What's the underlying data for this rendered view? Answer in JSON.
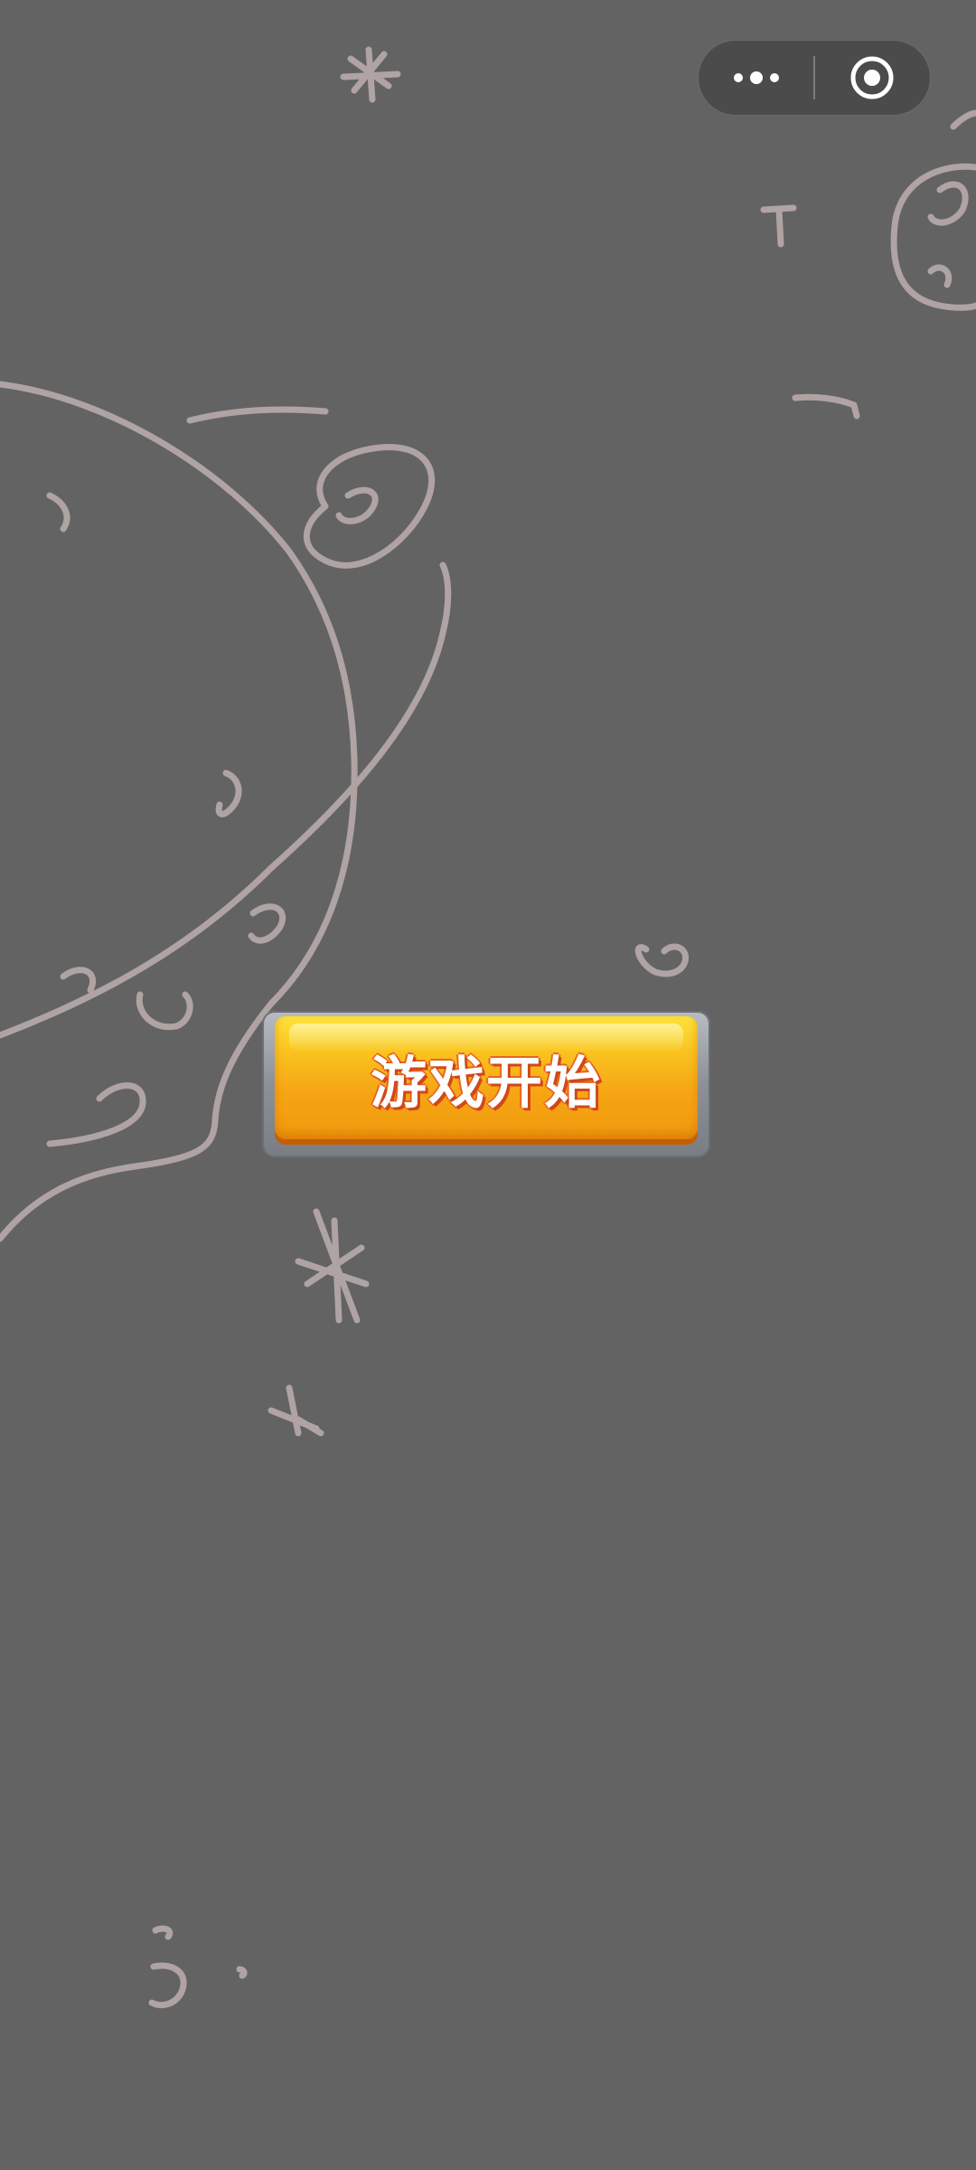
{
  "capsule": {
    "more_icon": "more-dots-icon",
    "close_icon": "target-circle-icon"
  },
  "start_button": {
    "label": "游戏开始"
  },
  "background": {
    "color": "#636363",
    "chalk_color": "#b8aaaa"
  },
  "accent_colors": {
    "button_top": "#fde23a",
    "button_bottom": "#f09a0e",
    "label_outline": "#d2471a"
  }
}
